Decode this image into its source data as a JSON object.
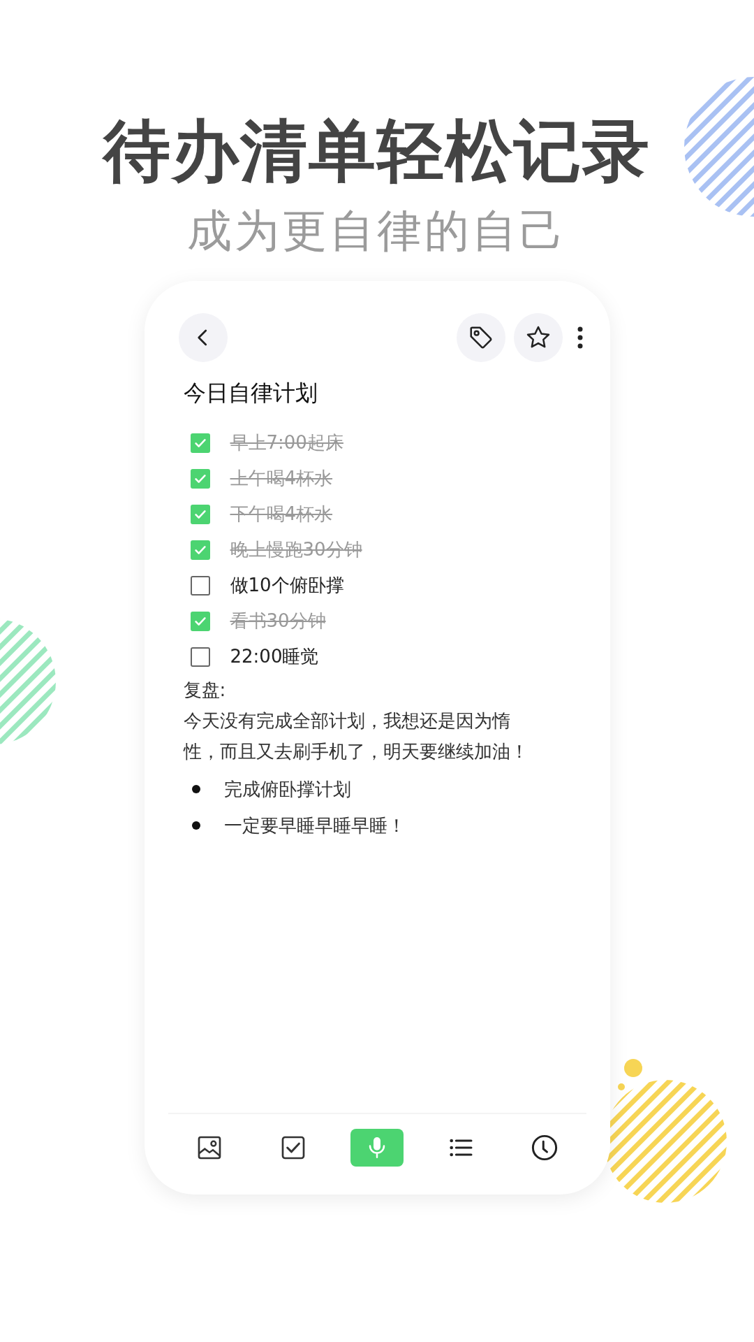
{
  "headline": "待办清单轻松记录",
  "subheadline": "成为更自律的自己",
  "note": {
    "title": "今日自律计划",
    "checklist": [
      {
        "text": "早上7:00起床",
        "checked": true
      },
      {
        "text": "上午喝4杯水",
        "checked": true
      },
      {
        "text": "下午喝4杯水",
        "checked": true
      },
      {
        "text": "晚上慢跑30分钟",
        "checked": true
      },
      {
        "text": "做10个俯卧撑",
        "checked": false
      },
      {
        "text": "看书30分钟",
        "checked": true
      },
      {
        "text": "22:00睡觉",
        "checked": false
      }
    ],
    "review_label": "复盘:",
    "review_text": "今天没有完成全部计划，我想还是因为惰性，而且又去刷手机了，明天要继续加油！",
    "bullets": [
      "完成俯卧撑计划",
      "一定要早睡早睡早睡！"
    ]
  },
  "bottom_toolbar": [
    {
      "selected": false
    },
    {
      "selected": false
    },
    {
      "selected": true
    },
    {
      "selected": false
    },
    {
      "selected": false
    }
  ]
}
